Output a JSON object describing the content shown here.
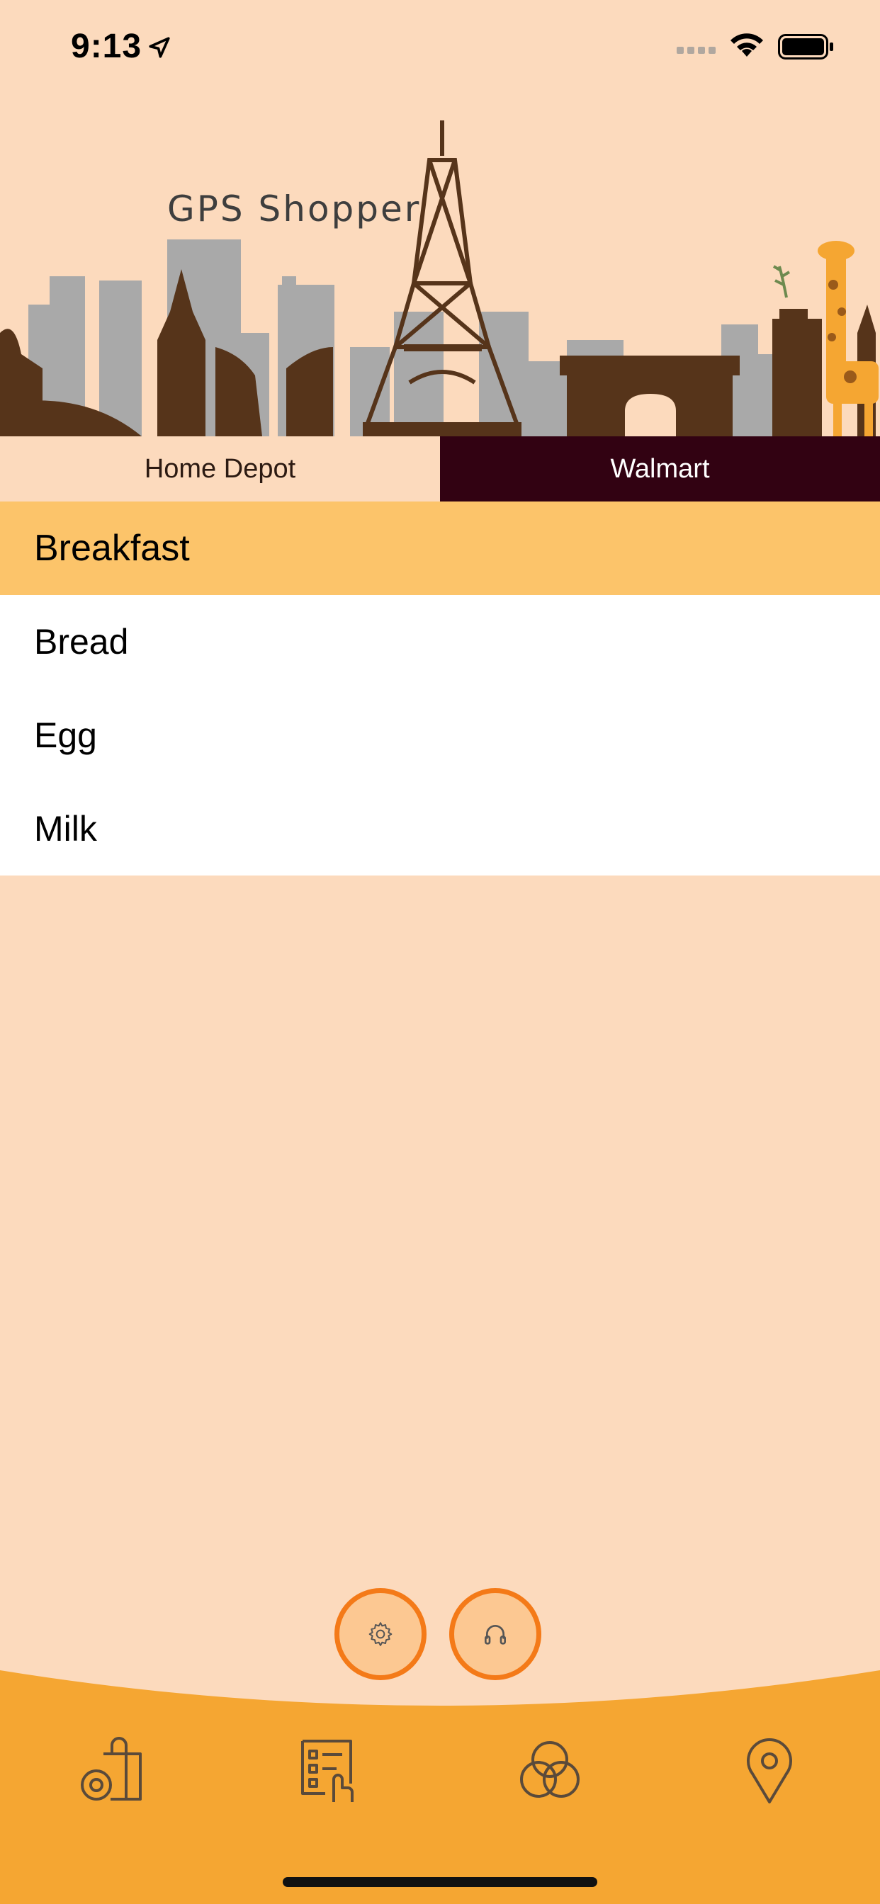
{
  "status_bar": {
    "time": "9:13",
    "icons": [
      "location-arrow-icon",
      "signal-icon",
      "wifi-icon",
      "battery-icon"
    ]
  },
  "header": {
    "title": "GPS Shopper",
    "illustration": "city-skyline-eiffel-tower-giraffe"
  },
  "store_tabs": [
    {
      "label": "Home Depot",
      "selected": false
    },
    {
      "label": "Walmart",
      "selected": true
    }
  ],
  "list": {
    "category": "Breakfast",
    "items": [
      "Bread",
      "Egg",
      "Milk"
    ]
  },
  "fabs": [
    {
      "icon": "gear-icon"
    },
    {
      "icon": "headphones-icon"
    }
  ],
  "bottom_nav": [
    {
      "icon": "shopping-bag-icon"
    },
    {
      "icon": "checklist-icon"
    },
    {
      "icon": "circles-icon"
    },
    {
      "icon": "map-pin-icon"
    }
  ],
  "colors": {
    "background": "#FCDABD",
    "category": "#FCC46A",
    "active_tab": "#320212",
    "bottom_bar": "#F5A632",
    "fab_border": "#F47A18",
    "skyline_dark": "#56341A",
    "skyline_gray": "#A9A9A9"
  }
}
